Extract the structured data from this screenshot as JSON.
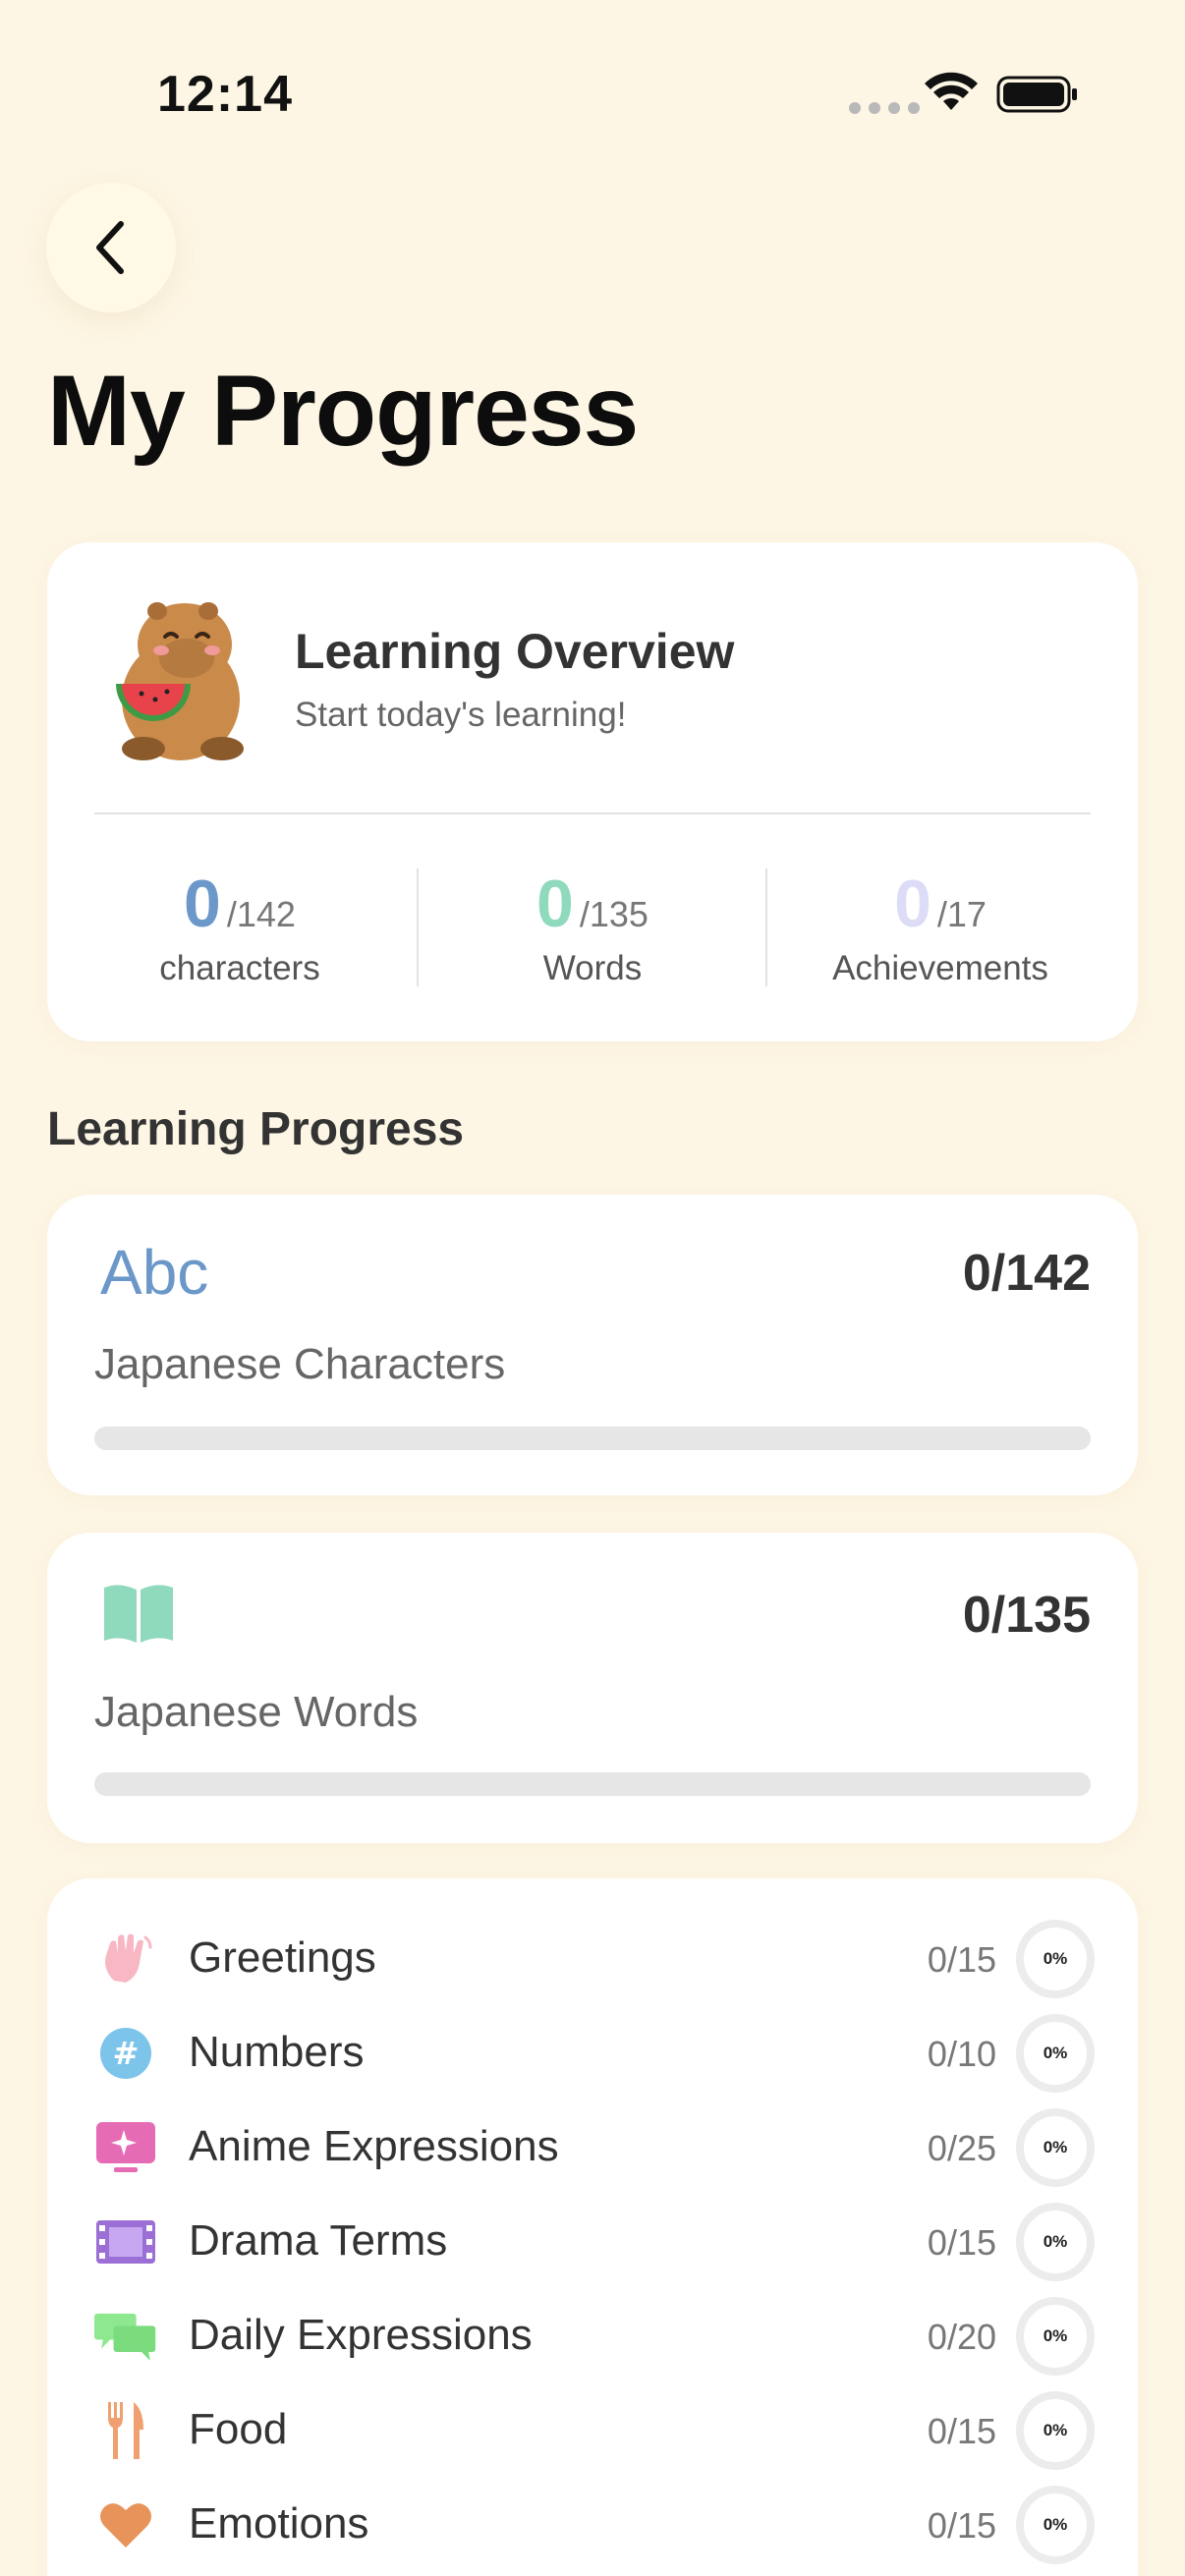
{
  "status_bar": {
    "time": "12:14"
  },
  "page": {
    "title": "My Progress"
  },
  "overview": {
    "title": "Learning Overview",
    "subtitle": "Start today's learning!",
    "stats": [
      {
        "value": "0",
        "total": "/142",
        "label": "characters",
        "color": "#6b98c9"
      },
      {
        "value": "0",
        "total": "/135",
        "label": "Words",
        "color": "#8fd9bd"
      },
      {
        "value": "0",
        "total": "/17",
        "label": "Achievements",
        "color": "#dcdcf7"
      }
    ]
  },
  "learning_progress": {
    "section_title": "Learning Progress",
    "cards": [
      {
        "icon_text": "Abc",
        "icon": "abc-icon",
        "count": "0/142",
        "title": "Japanese Characters",
        "progress": 0
      },
      {
        "icon": "book-icon",
        "count": "0/135",
        "title": "Japanese Words",
        "progress": 0
      }
    ]
  },
  "categories": [
    {
      "label": "Greetings",
      "count": "0/15",
      "percent": "0%",
      "icon": "waving-hand-icon"
    },
    {
      "label": "Numbers",
      "count": "0/10",
      "percent": "0%",
      "icon": "hash-icon"
    },
    {
      "label": "Anime Expressions",
      "count": "0/25",
      "percent": "0%",
      "icon": "sparkle-screen-icon"
    },
    {
      "label": "Drama Terms",
      "count": "0/15",
      "percent": "0%",
      "icon": "film-icon"
    },
    {
      "label": "Daily Expressions",
      "count": "0/20",
      "percent": "0%",
      "icon": "chat-bubbles-icon"
    },
    {
      "label": "Food",
      "count": "0/15",
      "percent": "0%",
      "icon": "fork-knife-icon"
    },
    {
      "label": "Emotions",
      "count": "0/15",
      "percent": "0%",
      "icon": "heart-icon"
    }
  ],
  "colors": {
    "background": "#fdf6e4",
    "characters_accent": "#6b98c9",
    "words_accent": "#8fd9bd",
    "achievements_accent": "#dcdcf7"
  }
}
